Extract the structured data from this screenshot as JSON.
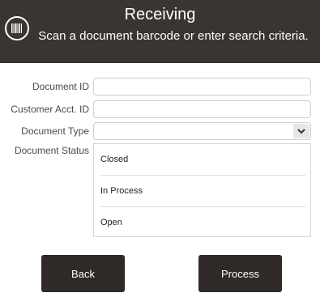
{
  "header": {
    "title": "Receiving",
    "subtitle": "Scan a document barcode or enter search criteria.",
    "icon": "barcode-icon"
  },
  "form": {
    "document_id_label": "Document ID",
    "document_id_value": "",
    "customer_acct_label": "Customer Acct. ID",
    "customer_acct_value": "",
    "document_type_label": "Document Type",
    "document_type_value": "",
    "document_status_label": "Document Status",
    "status_options": [
      "Closed",
      "In Process",
      "Open"
    ]
  },
  "buttons": {
    "back_label": "Back",
    "process_label": "Process"
  },
  "colors": {
    "header_bg": "#3a3532",
    "button_bg": "#2f2a27"
  }
}
